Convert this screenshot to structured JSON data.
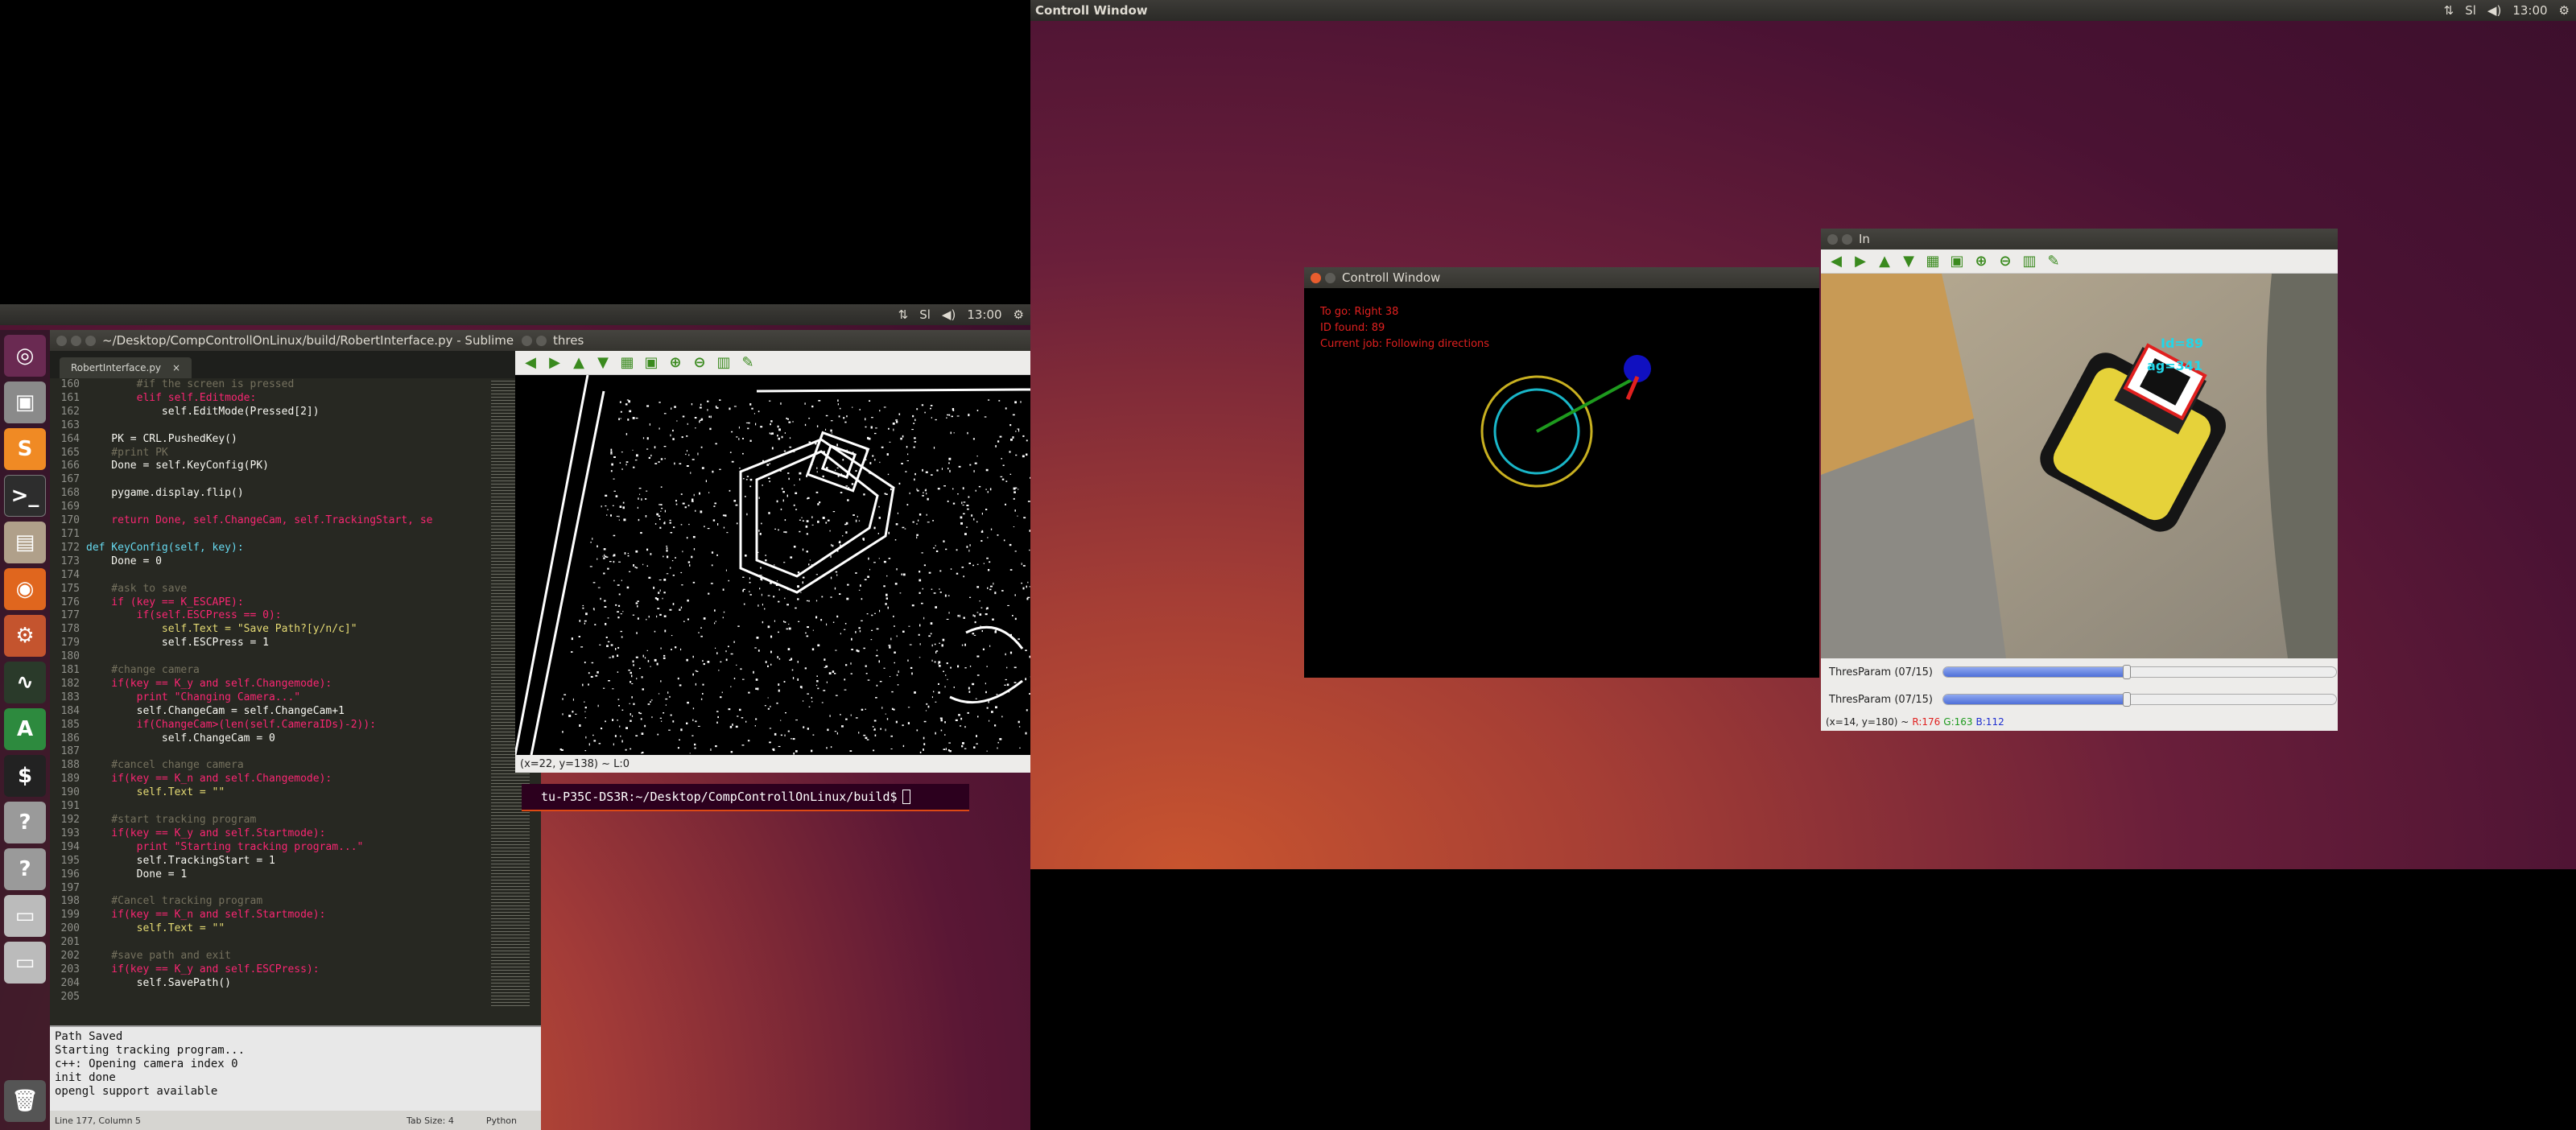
{
  "topbars": {
    "right": {
      "title": "Controll Window",
      "time": "13:00"
    },
    "left": {
      "time": "13:00"
    }
  },
  "indicators": {
    "arrows": "⇅",
    "lang": "Sl",
    "vol": "◀)",
    "gear": "⚙"
  },
  "launcher": [
    "ubuntu",
    "camera",
    "sublime",
    "terminal",
    "files",
    "firefox",
    "settings",
    "monitor",
    "software",
    "terminal2",
    "unknown1",
    "unknown2",
    "drive1",
    "drive2",
    "trash"
  ],
  "sublime": {
    "title": "~/Desktop/CompControllOnLinux/build/RobertInterface.py - Sublime",
    "tab": "RobertInterface.py",
    "tab_close": "×",
    "code": [
      {
        "n": "160",
        "t": "        #if the screen is pressed"
      },
      {
        "n": "161",
        "t": "        elif self.Editmode:"
      },
      {
        "n": "162",
        "t": "            self.EditMode(Pressed[2])"
      },
      {
        "n": "163",
        "t": ""
      },
      {
        "n": "164",
        "t": "    PK = CRL.PushedKey()"
      },
      {
        "n": "165",
        "t": "    #print PK"
      },
      {
        "n": "166",
        "t": "    Done = self.KeyConfig(PK)"
      },
      {
        "n": "167",
        "t": ""
      },
      {
        "n": "168",
        "t": "    pygame.display.flip()"
      },
      {
        "n": "169",
        "t": ""
      },
      {
        "n": "170",
        "t": "    return Done, self.ChangeCam, self.TrackingStart, se"
      },
      {
        "n": "171",
        "t": ""
      },
      {
        "n": "172",
        "t": "def KeyConfig(self, key):"
      },
      {
        "n": "173",
        "t": "    Done = 0"
      },
      {
        "n": "174",
        "t": ""
      },
      {
        "n": "175",
        "t": "    #ask to save"
      },
      {
        "n": "176",
        "t": "    if (key == K_ESCAPE):"
      },
      {
        "n": "177",
        "t": "        if(self.ESCPress == 0):"
      },
      {
        "n": "178",
        "t": "            self.Text = \"Save Path?[y/n/c]\""
      },
      {
        "n": "179",
        "t": "            self.ESCPress = 1"
      },
      {
        "n": "180",
        "t": ""
      },
      {
        "n": "181",
        "t": "    #change camera"
      },
      {
        "n": "182",
        "t": "    if(key == K_y and self.Changemode):"
      },
      {
        "n": "183",
        "t": "        print \"Changing Camera...\""
      },
      {
        "n": "184",
        "t": "        self.ChangeCam = self.ChangeCam+1"
      },
      {
        "n": "185",
        "t": "        if(ChangeCam>(len(self.CameraIDs)-2)):"
      },
      {
        "n": "186",
        "t": "            self.ChangeCam = 0"
      },
      {
        "n": "187",
        "t": ""
      },
      {
        "n": "188",
        "t": "    #cancel change camera"
      },
      {
        "n": "189",
        "t": "    if(key == K_n and self.Changemode):"
      },
      {
        "n": "190",
        "t": "        self.Text = \"\""
      },
      {
        "n": "191",
        "t": ""
      },
      {
        "n": "192",
        "t": "    #start tracking program"
      },
      {
        "n": "193",
        "t": "    if(key == K_y and self.Startmode):"
      },
      {
        "n": "194",
        "t": "        print \"Starting tracking program...\""
      },
      {
        "n": "195",
        "t": "        self.TrackingStart = 1"
      },
      {
        "n": "196",
        "t": "        Done = 1"
      },
      {
        "n": "197",
        "t": ""
      },
      {
        "n": "198",
        "t": "    #Cancel tracking program"
      },
      {
        "n": "199",
        "t": "    if(key == K_n and self.Startmode):"
      },
      {
        "n": "200",
        "t": "        self.Text = \"\""
      },
      {
        "n": "201",
        "t": ""
      },
      {
        "n": "202",
        "t": "    #save path and exit"
      },
      {
        "n": "203",
        "t": "    if(key == K_y and self.ESCPress):"
      },
      {
        "n": "204",
        "t": "        self.SavePath()"
      },
      {
        "n": "205",
        "t": ""
      }
    ],
    "console": "Path Saved\nStarting tracking program...\nc++: Opening camera index 0\ninit done\nopengl support available",
    "status_left": "Line 177, Column 5",
    "status_tab": "Tab Size: 4",
    "status_lang": "Python"
  },
  "thres": {
    "title": "thres",
    "status": "(x=22, y=138) ~ L:0"
  },
  "terminal": {
    "prompt": "tu-P35C-DS3R:~/Desktop/CompControllOnLinux/build$"
  },
  "controll": {
    "title": "Controll Window",
    "line1": "To go: Right 38",
    "line2": "ID found: 89",
    "line3": "Current job: Following directions"
  },
  "in": {
    "title": "In",
    "label_id": "Id=89",
    "label_ang": "ag=341",
    "slider1_label": "ThresParam (07/15)",
    "slider1_value": 0.467,
    "slider2_label": "ThresParam (07/15)",
    "slider2_value": 0.467,
    "status_xy": "(x=14, y=180) ~",
    "status_r": "R:176",
    "status_g": "G:163",
    "status_b": "B:112"
  },
  "colors": {
    "r": "#e0201f",
    "g": "#1e9a1e",
    "b": "#2030d0",
    "accent": "#dd4814"
  }
}
